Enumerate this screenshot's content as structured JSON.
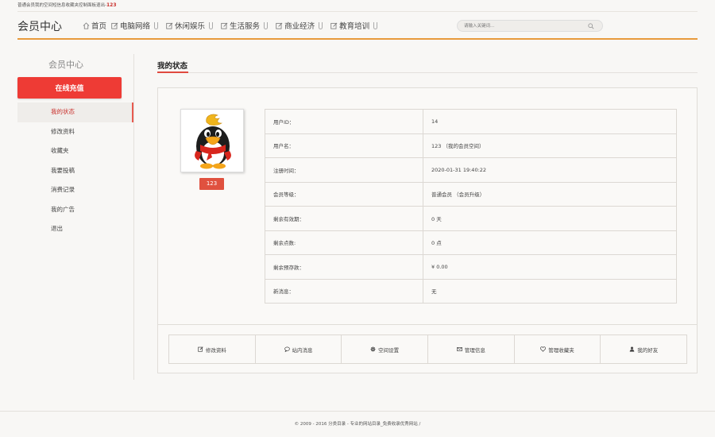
{
  "topbar": {
    "text": "普通会员我的空间短信息收藏夹控制面板退出-",
    "username": "123"
  },
  "header": {
    "logo": "会员中心",
    "nav": [
      {
        "label": "首页",
        "icon": "home-icon"
      },
      {
        "label": "电脑网络",
        "icon": "edit-icon"
      },
      {
        "label": "休闲娱乐",
        "icon": "edit-icon"
      },
      {
        "label": "生活服务",
        "icon": "edit-icon"
      },
      {
        "label": "商业经济",
        "icon": "edit-icon"
      },
      {
        "label": "教育培训",
        "icon": "edit-icon"
      }
    ],
    "search_placeholder": "请输入关键词..."
  },
  "sidebar": {
    "title": "会员中心",
    "recharge": "在线充值",
    "items": [
      {
        "label": "我的状态",
        "active": true
      },
      {
        "label": "修改资料",
        "active": false
      },
      {
        "label": "收藏夹",
        "active": false
      },
      {
        "label": "我要投稿",
        "active": false
      },
      {
        "label": "消费记录",
        "active": false
      },
      {
        "label": "我的广告",
        "active": false
      },
      {
        "label": "退出",
        "active": false
      }
    ]
  },
  "main": {
    "title": "我的状态",
    "avatar_name": "123",
    "info": [
      {
        "key": "用户ID：",
        "value": "14"
      },
      {
        "key": "用户名：",
        "value": "123 （我的会员空间）"
      },
      {
        "key": "注册时间：",
        "value": "2020-01-31 19:40:22"
      },
      {
        "key": "会员等级：",
        "value": "普通会员 （会员升级）"
      },
      {
        "key": "剩余有效期：",
        "value": "0 天"
      },
      {
        "key": "剩余点数:",
        "value": "0 点"
      },
      {
        "key": "剩余预存款：",
        "value": "¥ 0.00"
      },
      {
        "key": "新消息：",
        "value": "无"
      }
    ],
    "actions": [
      {
        "label": "修改资料",
        "icon": "edit-icon"
      },
      {
        "label": "站内消息",
        "icon": "comment-icon"
      },
      {
        "label": "空间设置",
        "icon": "gear-icon"
      },
      {
        "label": "管理信息",
        "icon": "envelope-icon"
      },
      {
        "label": "管理收藏夹",
        "icon": "heart-icon"
      },
      {
        "label": "我的好友",
        "icon": "user-icon"
      }
    ]
  },
  "footer": {
    "text": "© 2009 - 2016 分类目录 - 专业的网站目录_免费收录优秀网站 /"
  },
  "colors": {
    "accent_orange": "#e89a3c",
    "recharge_red": "#ee3b35",
    "active_red": "#c9302c"
  }
}
